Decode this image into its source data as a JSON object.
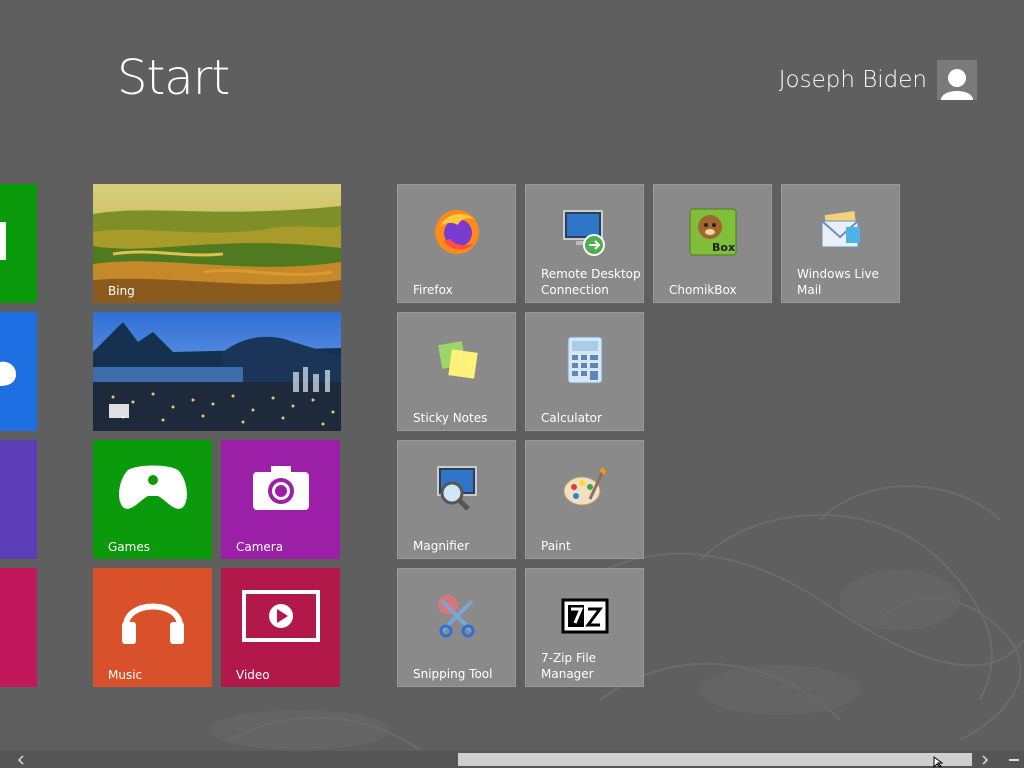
{
  "screen": {
    "title": "Start"
  },
  "user": {
    "name": "Joseph Biden",
    "icon": "user-silhouette-icon"
  },
  "tiles": {
    "bing": {
      "label": "Bing"
    },
    "travel": {
      "label": ""
    },
    "games": {
      "label": "Games",
      "icon": "xbox-controller-icon"
    },
    "camera": {
      "label": "Camera",
      "icon": "camera-icon"
    },
    "music": {
      "label": "Music",
      "icon": "headphones-icon"
    },
    "video": {
      "label": "Video",
      "icon": "video-play-icon"
    },
    "firefox": {
      "label": "Firefox",
      "icon": "firefox-icon"
    },
    "remote_desktop": {
      "label": "Remote Desktop\nConnection",
      "icon": "remote-desktop-icon"
    },
    "chomikbox": {
      "label": "ChomikBox",
      "icon": "chomikbox-icon"
    },
    "windows_live_mail": {
      "label": "Windows Live\nMail",
      "icon": "mail-icon"
    },
    "sticky_notes": {
      "label": "Sticky Notes",
      "icon": "sticky-notes-icon"
    },
    "calculator": {
      "label": "Calculator",
      "icon": "calculator-icon"
    },
    "magnifier": {
      "label": "Magnifier",
      "icon": "magnifier-icon"
    },
    "paint": {
      "label": "Paint",
      "icon": "paint-palette-icon"
    },
    "snipping_tool": {
      "label": "Snipping Tool",
      "icon": "scissors-icon"
    },
    "sevenzip": {
      "label": "7-Zip File\nManager",
      "icon": "7zip-icon"
    }
  },
  "colors": {
    "background": "#5f5f5f",
    "tile_gray": "#8a8a8a",
    "green": "#0b9a0b",
    "blue": "#1d6ee0",
    "purple": "#5b3db8",
    "crimson": "#c2185b",
    "magenta": "#9c1fa8",
    "orange": "#d9512a",
    "rose": "#b3184a"
  },
  "scrollbar": {
    "left_icon": "chevron-left-icon",
    "right_icon": "chevron-right-icon",
    "zoom_icon": "semantic-zoom-icon"
  }
}
